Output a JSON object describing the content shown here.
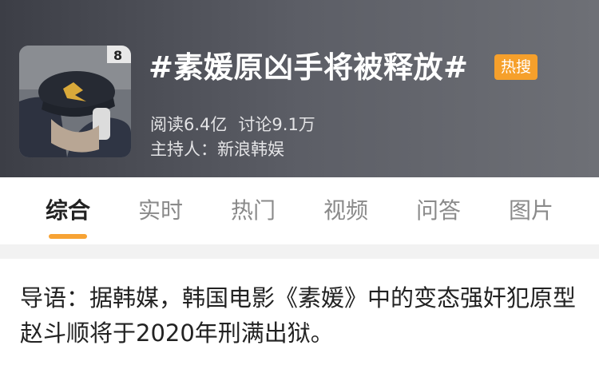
{
  "topic": {
    "title": "#素媛原凶手将被释放#",
    "badge": "热搜",
    "badge_color": "#f6a02b",
    "read_count": "阅读6.4亿",
    "discussion_count": "讨论9.1万",
    "host": "主持人：新浪韩娱"
  },
  "tabs": [
    {
      "label": "综合",
      "active": true
    },
    {
      "label": "实时",
      "active": false
    },
    {
      "label": "热门",
      "active": false
    },
    {
      "label": "视频",
      "active": false
    },
    {
      "label": "问答",
      "active": false
    },
    {
      "label": "图片",
      "active": false
    }
  ],
  "guide": {
    "text": "导语：据韩媒，韩国电影《素媛》中的变态强奸犯原型赵斗顺将于2020年刑满出狱。"
  },
  "accent_color": "#f7a334"
}
